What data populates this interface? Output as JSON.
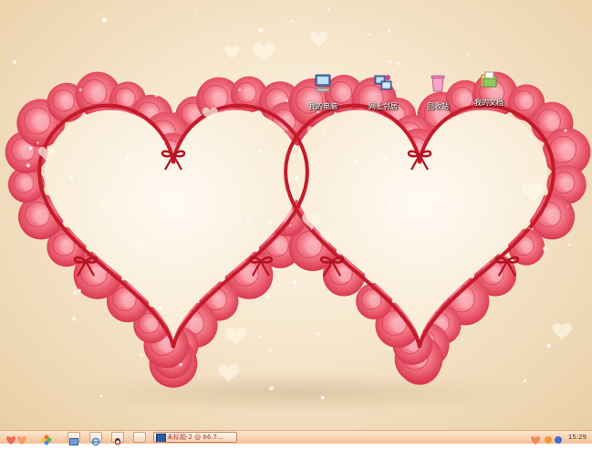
{
  "desktop": {
    "icons": [
      {
        "label": "我的电脑",
        "icon": "my-computer-icon"
      },
      {
        "label": "网上邻居",
        "icon": "network-icon"
      },
      {
        "label": "回收站",
        "icon": "recycle-bin-icon"
      },
      {
        "label": "我的文档",
        "icon": "my-documents-icon"
      }
    ]
  },
  "taskbar": {
    "quick_launch": [
      {
        "icon": "start-heart-icon"
      },
      {
        "icon": "flower-icon"
      },
      {
        "icon": "show-desktop-icon"
      },
      {
        "icon": "ie-icon"
      },
      {
        "icon": "qq-icon"
      },
      {
        "icon": "blank-icon"
      }
    ],
    "task_label": "未标题-2 @ 66.7...",
    "clock": "15:29"
  },
  "colors": {
    "rose": "#e8556b",
    "ribbon": "#c21a2a",
    "background": "#f6e6cc",
    "taskbar": "#f7cfae"
  }
}
